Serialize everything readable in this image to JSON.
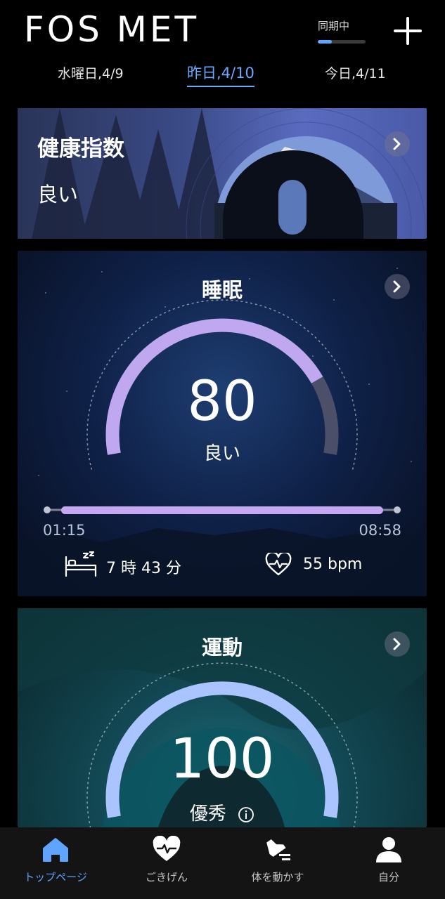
{
  "app": {
    "logo": "FOS MET"
  },
  "header": {
    "sync_label": "同期中",
    "sync_progress": 0.3,
    "dates": [
      "水曜日,4/9",
      "昨日,4/10",
      "今日,4/11"
    ],
    "active_date_index": 1
  },
  "health": {
    "title": "健康指数",
    "status": "良い"
  },
  "sleep": {
    "title": "睡眠",
    "score": "80",
    "score_value": 80,
    "status": "良い",
    "start_time": "01:15",
    "end_time": "08:58",
    "duration": "7 時 43 分",
    "heart_rate": "55 bpm"
  },
  "motion": {
    "title": "運動",
    "score": "100",
    "score_value": 100,
    "status": "優秀"
  },
  "nav": {
    "items": [
      {
        "label": "トップページ",
        "icon": "home-icon"
      },
      {
        "label": "ごきげん",
        "icon": "heart-pulse-icon"
      },
      {
        "label": "体を動かす",
        "icon": "running-shoe-icon"
      },
      {
        "label": "自分",
        "icon": "person-icon"
      }
    ],
    "active_index": 0
  },
  "colors": {
    "accent": "#5fa4ff",
    "sleep_gauge": "#c0a8f0",
    "motion_gauge": "#a9c4ff"
  }
}
